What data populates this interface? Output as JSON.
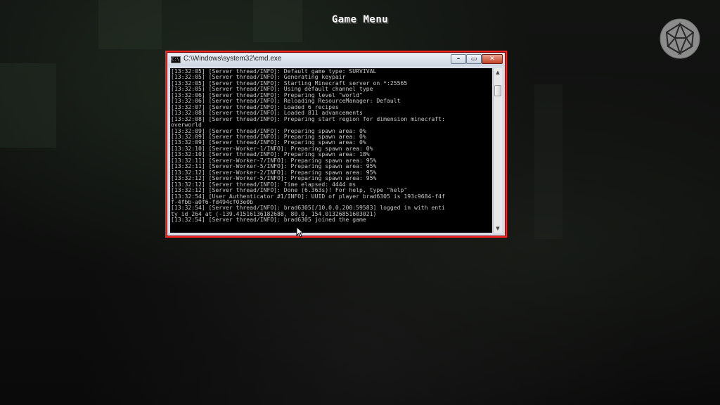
{
  "game": {
    "menu_title": "Game Menu"
  },
  "window": {
    "title": "C:\\Windows\\system32\\cmd.exe",
    "buttons": {
      "minimize": "–",
      "maximize": "▭",
      "close": "✕"
    },
    "icon_text": "C:\\"
  },
  "console": {
    "lines": [
      "[13:32:05] [Server thread/INFO]: Default game type: SURVIVAL",
      "[13:32:05] [Server thread/INFO]: Generating keypair",
      "[13:32:05] [Server thread/INFO]: Starting Minecraft server on *:25565",
      "[13:32:05] [Server thread/INFO]: Using default channel type",
      "[13:32:06] [Server thread/INFO]: Preparing level \"world\"",
      "[13:32:06] [Server thread/INFO]: Reloading ResourceManager: Default",
      "[13:32:07] [Server thread/INFO]: Loaded 6 recipes",
      "[13:32:08] [Server thread/INFO]: Loaded 811 advancements",
      "[13:32:08] [Server thread/INFO]: Preparing start region for dimension minecraft:",
      "overworld",
      "[13:32:09] [Server thread/INFO]: Preparing spawn area: 0%",
      "[13:32:09] [Server thread/INFO]: Preparing spawn area: 0%",
      "[13:32:09] [Server thread/INFO]: Preparing spawn area: 0%",
      "[13:32:10] [Server-Worker-1/INFO]: Preparing spawn area: 0%",
      "[13:32:10] [Server thread/INFO]: Preparing spawn area: 18%",
      "[13:32:11] [Server-Worker-7/INFO]: Preparing spawn area: 95%",
      "[13:32:11] [Server-Worker-5/INFO]: Preparing spawn area: 95%",
      "[13:32:12] [Server-Worker-2/INFO]: Preparing spawn area: 95%",
      "[13:32:12] [Server-Worker-5/INFO]: Preparing spawn area: 95%",
      "[13:32:12] [Server thread/INFO]: Time elapsed: 4444 ms",
      "[13:32:12] [Server thread/INFO]: Done (6.363s)! For help, type \"help\"",
      "[13:32:54] [User Authenticator #1/INFO]: UUID of player brad6305 is 193c9684-f4f",
      "f-4fbb-a0f6-fd494cf03e0b",
      "[13:32:54] [Server thread/INFO]: brad6305[/10.0.0.200:59583] logged in with enti",
      "ty id 264 at (-139.41516136182688, 80.0, 154.01326851603021)",
      "[13:32:54] [Server thread/INFO]: brad6305 joined the game"
    ]
  },
  "icons": [
    "d20-dice-icon",
    "cmd-icon",
    "mouse-cursor-icon"
  ],
  "colors": {
    "highlight_border": "#ff2424",
    "console_bg": "#000000",
    "console_text": "#c8c8c8"
  }
}
